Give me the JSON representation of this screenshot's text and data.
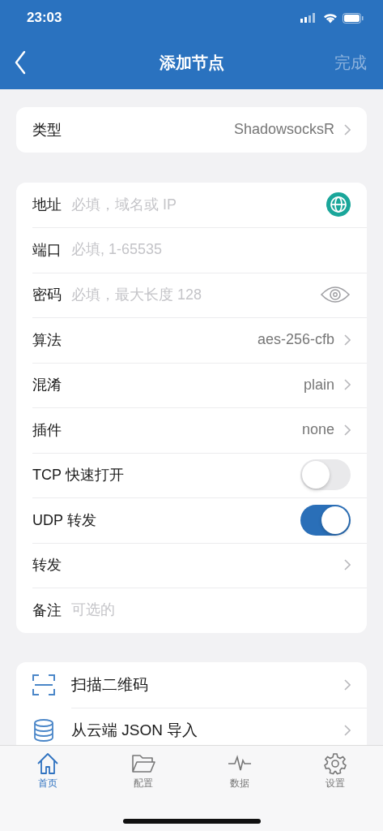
{
  "status_bar": {
    "time": "23:03"
  },
  "nav": {
    "title": "添加节点",
    "done": "完成"
  },
  "type_row": {
    "label": "类型",
    "value": "ShadowsocksR"
  },
  "fields": [
    {
      "kind": "address",
      "label": "地址",
      "placeholder": "必填，域名或 IP"
    },
    {
      "kind": "input",
      "label": "端口",
      "placeholder": "必填, 1-65535"
    },
    {
      "kind": "secret",
      "label": "密码",
      "placeholder": "必填，最大长度 128"
    },
    {
      "kind": "picker",
      "label": "算法",
      "value": "aes-256-cfb"
    },
    {
      "kind": "picker",
      "label": "混淆",
      "value": "plain"
    },
    {
      "kind": "picker",
      "label": "插件",
      "value": "none"
    },
    {
      "kind": "toggle",
      "label": "TCP 快速打开",
      "on": false
    },
    {
      "kind": "toggle",
      "label": "UDP 转发",
      "on": true
    },
    {
      "kind": "link",
      "label": "转发"
    },
    {
      "kind": "input",
      "label": "备注",
      "placeholder": "可选的"
    }
  ],
  "actions": [
    {
      "kind": "scan",
      "label": "扫描二维码"
    },
    {
      "kind": "database",
      "label": "从云端 JSON 导入"
    }
  ],
  "tabs": [
    {
      "kind": "home",
      "label": "首页",
      "selected": true
    },
    {
      "kind": "folder",
      "label": "配置",
      "selected": false
    },
    {
      "kind": "pulse",
      "label": "数据",
      "selected": false
    },
    {
      "kind": "gear",
      "label": "设置",
      "selected": false
    }
  ]
}
